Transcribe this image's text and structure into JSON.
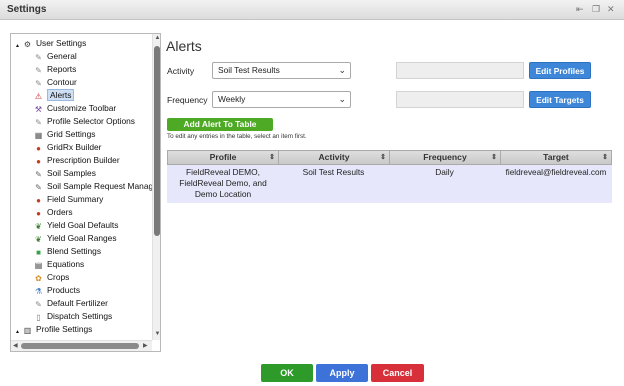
{
  "window": {
    "title": "Settings",
    "controls": [
      "⇤",
      "❐",
      "✕"
    ]
  },
  "tree": {
    "items": [
      {
        "label": "User Settings",
        "icon": "user-gear-icon",
        "level": 0,
        "expander": "▲"
      },
      {
        "label": "General",
        "icon": "wrench-icon",
        "level": 1
      },
      {
        "label": "Reports",
        "icon": "wrench-icon",
        "level": 1
      },
      {
        "label": "Contour",
        "icon": "wrench-icon",
        "level": 1
      },
      {
        "label": "Alerts",
        "icon": "warning-icon",
        "level": 1,
        "selected": true
      },
      {
        "label": "Customize Toolbar",
        "icon": "tools-icon",
        "level": 1
      },
      {
        "label": "Profile Selector Options",
        "icon": "wrench-icon",
        "level": 1
      },
      {
        "label": "Grid Settings",
        "icon": "grid-icon",
        "level": 1
      },
      {
        "label": "GridRx Builder",
        "icon": "target-icon",
        "level": 1
      },
      {
        "label": "Prescription Builder",
        "icon": "target-icon",
        "level": 1
      },
      {
        "label": "Soil Samples",
        "icon": "pin-icon",
        "level": 1
      },
      {
        "label": "Soil Sample Request Manag",
        "icon": "pin-icon",
        "level": 1
      },
      {
        "label": "Field Summary",
        "icon": "target-icon",
        "level": 1
      },
      {
        "label": "Orders",
        "icon": "target-icon",
        "level": 1
      },
      {
        "label": "Yield Goal Defaults",
        "icon": "plant-icon",
        "level": 1
      },
      {
        "label": "Yield Goal Ranges",
        "icon": "plant-icon",
        "level": 1
      },
      {
        "label": "Blend Settings",
        "icon": "blend-icon",
        "level": 1
      },
      {
        "label": "Equations",
        "icon": "equation-icon",
        "level": 1
      },
      {
        "label": "Crops",
        "icon": "crop-icon",
        "level": 1
      },
      {
        "label": "Products",
        "icon": "flask-icon",
        "level": 1
      },
      {
        "label": "Default Fertilizer",
        "icon": "wrench-icon",
        "level": 1
      },
      {
        "label": "Dispatch Settings",
        "icon": "document-icon",
        "level": 1
      },
      {
        "label": "Profile Settings",
        "icon": "building-icon",
        "level": 0,
        "expander": "▲"
      }
    ]
  },
  "main": {
    "title": "Alerts",
    "activity": {
      "label": "Activity",
      "value": "Soil Test Results"
    },
    "frequency": {
      "label": "Frequency",
      "value": "Weekly"
    },
    "edit_profiles": "Edit Profiles",
    "edit_targets": "Edit Targets",
    "add_alert": "Add Alert To Table",
    "hint": "To edit any entries in the table, select an item first.",
    "table": {
      "columns": [
        "Profile",
        "Activity",
        "Frequency",
        "Target"
      ],
      "rows": [
        [
          "FieldReveal DEMO, FieldReveal Demo, and Demo Location",
          "Soil Test Results",
          "Daily",
          "fieldreveal@fieldreveal.com"
        ]
      ]
    }
  },
  "footer": {
    "ok": "OK",
    "apply": "Apply",
    "cancel": "Cancel"
  },
  "colors": {
    "ok": "#2d9a2a",
    "apply": "#3d73d8",
    "cancel": "#d8303a",
    "accent": "#3d86d8",
    "green": "#4eaa25"
  }
}
